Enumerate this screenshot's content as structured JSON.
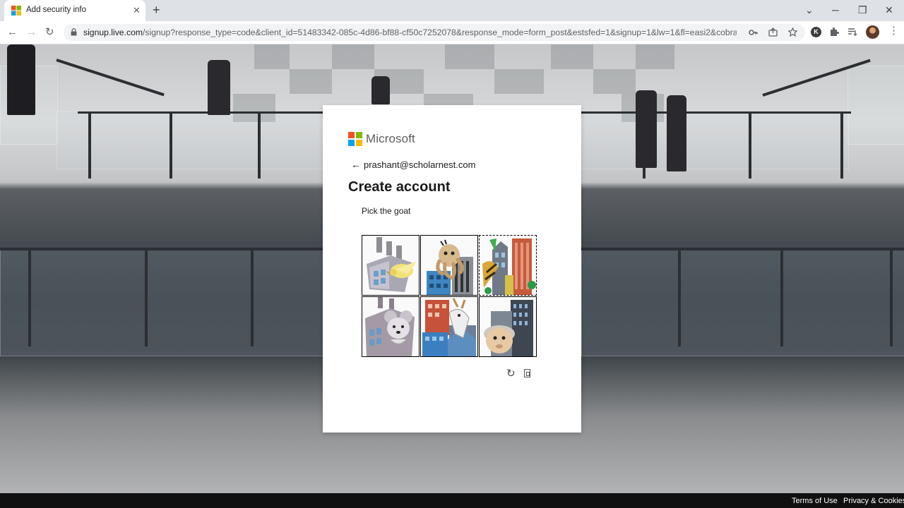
{
  "browser": {
    "tab_title": "Add security info",
    "tab_close": "✕",
    "new_tab": "+",
    "window_controls": {
      "minimize": "─",
      "restore": "❐",
      "close": "✕",
      "tab_search": "⌄"
    },
    "nav": {
      "back": "←",
      "forward": "→",
      "reload": "↻"
    },
    "url_host": "signup.live.com",
    "url_rest": "/signup?response_type=code&client_id=51483342-085c-4d86-bf88-cf50c7252078&response_mode=form_post&estsfed=1&signup=1&lw=1&fl=easi2&cobrandid...",
    "icons": [
      "lock-icon",
      "key-icon",
      "share-icon",
      "star-icon",
      "profile-k-icon",
      "extensions-icon",
      "reading-list-icon",
      "avatar"
    ],
    "profile_badge": "K"
  },
  "dialog": {
    "brand": "Microsoft",
    "brand_colors": [
      "#f25022",
      "#7fba00",
      "#00a4ef",
      "#ffb900"
    ],
    "back_glyph": "←",
    "email": "prashant@scholarnest.com",
    "heading": "Create account",
    "instruction": "Pick the goat",
    "captcha_cells": [
      {
        "label": "factory-with-bird"
      },
      {
        "label": "building-with-octopus"
      },
      {
        "label": "buildings-with-plant",
        "selected": true
      },
      {
        "label": "factory-with-mouse"
      },
      {
        "label": "buildings-with-goat"
      },
      {
        "label": "buildings-with-sheep"
      }
    ],
    "refresh_glyph": "↻"
  },
  "footer": {
    "terms": "Terms of Use",
    "privacy": "Privacy & Cookies"
  }
}
